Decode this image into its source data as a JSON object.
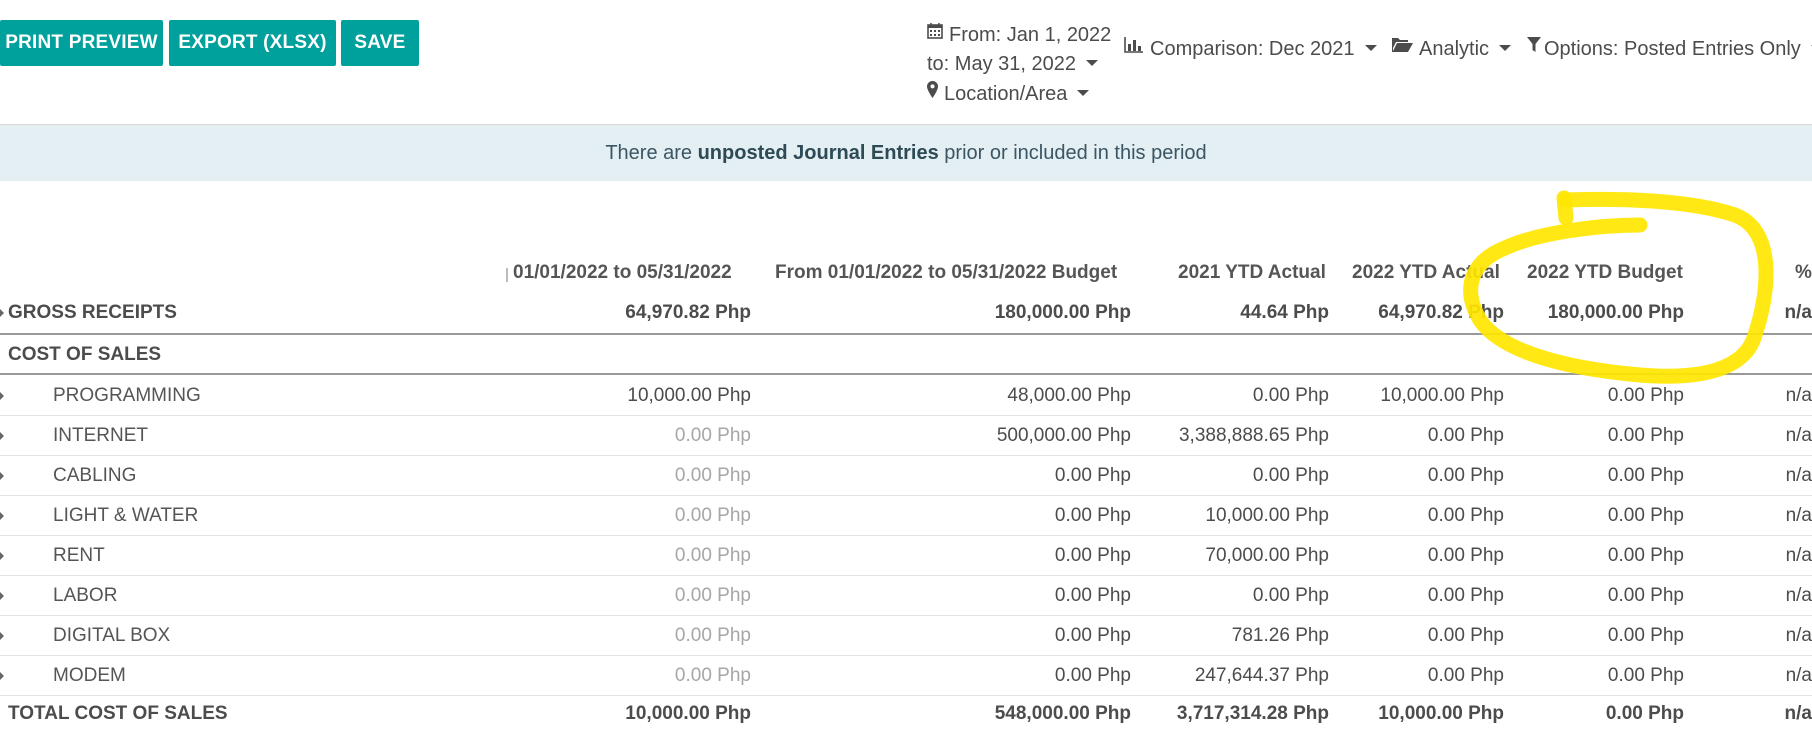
{
  "toolbar": {
    "print_preview": "PRINT PREVIEW",
    "export_xlsx": "EXPORT (XLSX)",
    "save": "SAVE"
  },
  "filters": {
    "date_from": "From: Jan 1, 2022",
    "date_to": "to: May 31, 2022",
    "location": "Location/Area",
    "comparison": "Comparison: Dec 2021",
    "analytic": "Analytic",
    "options": "Options: Posted Entries Only"
  },
  "alert": {
    "prefix": "There are ",
    "emph": "unposted Journal Entries",
    "suffix": " prior or included in this period"
  },
  "table": {
    "headers": [
      "01/01/2022 to 05/31/2022",
      "From 01/01/2022 to 05/31/2022 Budget",
      "2021 YTD Actual",
      "2022 YTD Actual",
      "2022 YTD Budget",
      "%"
    ],
    "gross_receipts": {
      "label": "GROSS RECEIPTS",
      "values": [
        "64,970.82 Php",
        "180,000.00 Php",
        "44.64 Php",
        "64,970.82 Php",
        "180,000.00 Php",
        "n/a"
      ]
    },
    "cost_of_sales_label": "COST OF SALES",
    "rows": [
      {
        "label": "PROGRAMMING",
        "values": [
          "10,000.00 Php",
          "48,000.00 Php",
          "0.00 Php",
          "10,000.00 Php",
          "0.00 Php",
          "n/a"
        ]
      },
      {
        "label": "INTERNET",
        "values": [
          "0.00 Php",
          "500,000.00 Php",
          "3,388,888.65 Php",
          "0.00 Php",
          "0.00 Php",
          "n/a"
        ]
      },
      {
        "label": "CABLING",
        "values": [
          "0.00 Php",
          "0.00 Php",
          "0.00 Php",
          "0.00 Php",
          "0.00 Php",
          "n/a"
        ]
      },
      {
        "label": "LIGHT & WATER",
        "values": [
          "0.00 Php",
          "0.00 Php",
          "10,000.00 Php",
          "0.00 Php",
          "0.00 Php",
          "n/a"
        ]
      },
      {
        "label": "RENT",
        "values": [
          "0.00 Php",
          "0.00 Php",
          "70,000.00 Php",
          "0.00 Php",
          "0.00 Php",
          "n/a"
        ]
      },
      {
        "label": "LABOR",
        "values": [
          "0.00 Php",
          "0.00 Php",
          "0.00 Php",
          "0.00 Php",
          "0.00 Php",
          "n/a"
        ]
      },
      {
        "label": "DIGITAL BOX",
        "values": [
          "0.00 Php",
          "0.00 Php",
          "781.26 Php",
          "0.00 Php",
          "0.00 Php",
          "n/a"
        ]
      },
      {
        "label": "MODEM",
        "values": [
          "0.00 Php",
          "0.00 Php",
          "247,644.37 Php",
          "0.00 Php",
          "0.00 Php",
          "n/a"
        ]
      }
    ],
    "total": {
      "label": "TOTAL COST OF SALES",
      "values": [
        "10,000.00 Php",
        "548,000.00 Php",
        "3,717,314.28 Php",
        "10,000.00 Php",
        "0.00 Php",
        "n/a"
      ]
    }
  },
  "colors": {
    "accent": "#00a09d",
    "annotation": "#ffe600",
    "alert_bg": "#e4eff3"
  }
}
